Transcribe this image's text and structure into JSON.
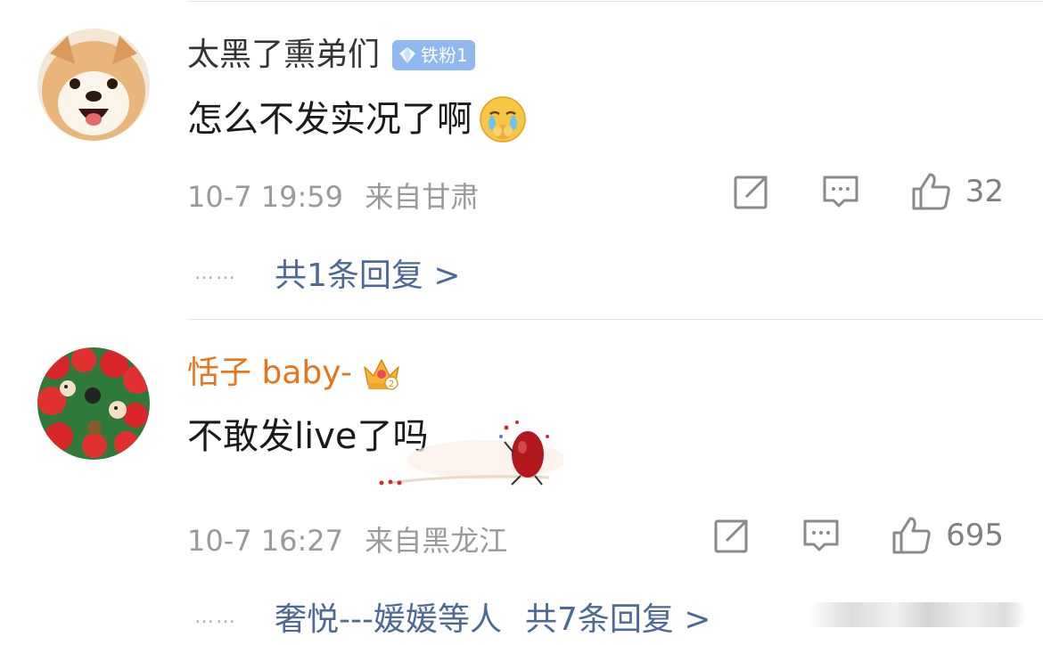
{
  "comments": [
    {
      "author": "太黑了熏弟们",
      "badge": "铁粉1",
      "text": "怎么不发实况了啊",
      "emoji": "crying-face-emoji",
      "date": "10-7 19:59",
      "location": "来自甘肃",
      "likes": "32",
      "replies_label": "共1条回复 >",
      "dots": "……"
    },
    {
      "author": "恬子 baby-",
      "badge_icon": "crown-icon",
      "text": "不敢发live了吗",
      "sticker": "red-bean-sticker",
      "date": "10-7 16:27",
      "location": "来自黑龙江",
      "likes": "695",
      "repliers_label": "奢悦---媛媛等人",
      "replies_label": "共7条回复 >",
      "dots": "……"
    }
  ],
  "colors": {
    "author_default": "#333333",
    "author_vip": "#e8741c",
    "link": "#4d6a96",
    "meta": "#9a9a9a",
    "badge_bg": "#8fb7f0"
  }
}
